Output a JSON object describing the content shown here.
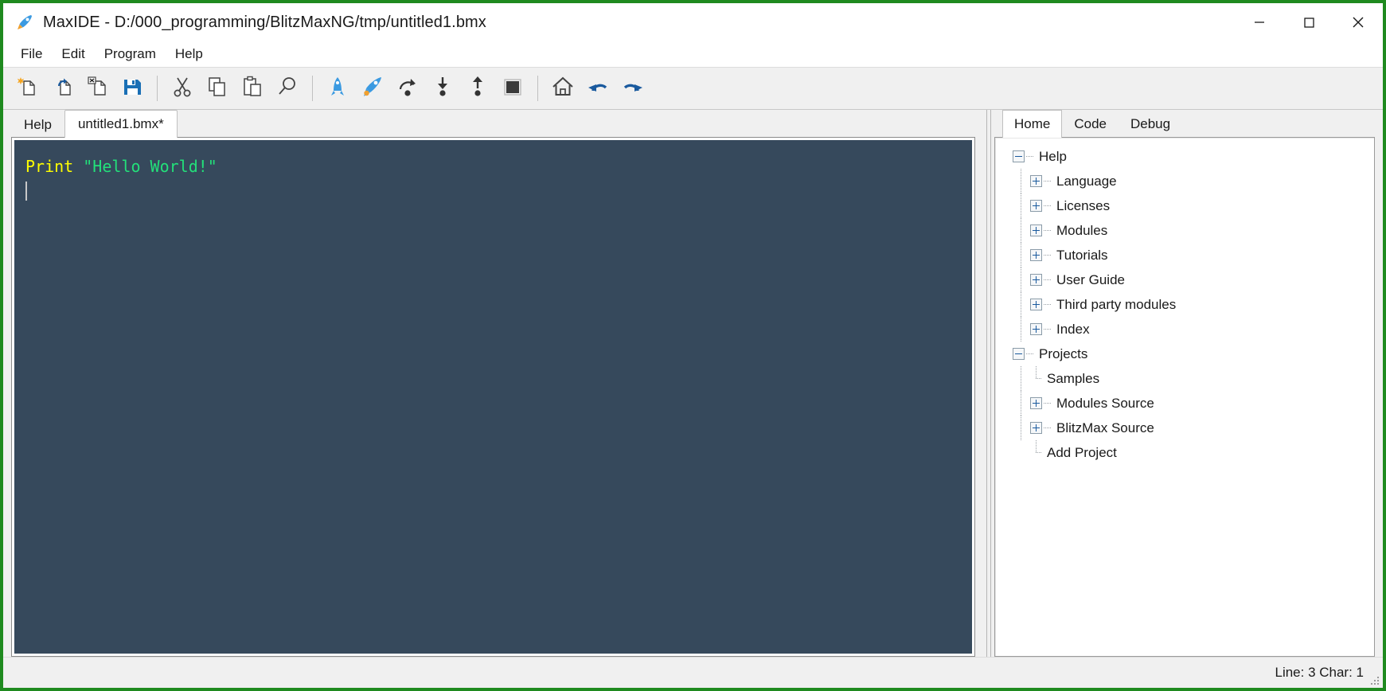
{
  "window": {
    "title": "MaxIDE - D:/000_programming/BlitzMaxNG/tmp/untitled1.bmx",
    "app_icon": "rocket-icon",
    "border_color": "#1f8a1f",
    "controls": {
      "minimize": "minimize-icon",
      "maximize": "maximize-icon",
      "close": "close-icon"
    }
  },
  "menubar": {
    "items": [
      {
        "label": "File"
      },
      {
        "label": "Edit"
      },
      {
        "label": "Program"
      },
      {
        "label": "Help"
      }
    ]
  },
  "toolbar": {
    "groups": [
      {
        "buttons": [
          {
            "name": "new-file-icon",
            "title": "New"
          },
          {
            "name": "open-file-icon",
            "title": "Open"
          },
          {
            "name": "close-file-icon",
            "title": "Close"
          },
          {
            "name": "save-file-icon",
            "title": "Save"
          }
        ]
      },
      {
        "buttons": [
          {
            "name": "cut-icon",
            "title": "Cut"
          },
          {
            "name": "copy-icon",
            "title": "Copy"
          },
          {
            "name": "paste-icon",
            "title": "Paste"
          },
          {
            "name": "search-icon",
            "title": "Find"
          }
        ]
      },
      {
        "buttons": [
          {
            "name": "build-icon",
            "title": "Build"
          },
          {
            "name": "run-icon",
            "title": "Build and Run"
          },
          {
            "name": "step-over-icon",
            "title": "Step Over"
          },
          {
            "name": "step-into-icon",
            "title": "Step Into"
          },
          {
            "name": "step-out-icon",
            "title": "Step Out"
          },
          {
            "name": "stop-icon",
            "title": "Stop"
          }
        ]
      },
      {
        "buttons": [
          {
            "name": "home-icon",
            "title": "Home"
          },
          {
            "name": "undo-icon",
            "title": "Undo"
          },
          {
            "name": "redo-icon",
            "title": "Redo"
          }
        ]
      }
    ]
  },
  "editor": {
    "tabs": [
      {
        "label": "Help",
        "active": false
      },
      {
        "label": "untitled1.bmx*",
        "active": true
      }
    ],
    "background": "#36495c",
    "code": {
      "keyword": "Print",
      "space": " ",
      "string": "\"Hello World!\""
    }
  },
  "help_panel": {
    "tabs": [
      {
        "label": "Home",
        "active": true
      },
      {
        "label": "Code",
        "active": false
      },
      {
        "label": "Debug",
        "active": false
      }
    ],
    "tree": [
      {
        "label": "Help",
        "depth": 0,
        "expander": "minus"
      },
      {
        "label": "Language",
        "depth": 1,
        "expander": "plus"
      },
      {
        "label": "Licenses",
        "depth": 1,
        "expander": "plus"
      },
      {
        "label": "Modules",
        "depth": 1,
        "expander": "plus"
      },
      {
        "label": "Tutorials",
        "depth": 1,
        "expander": "plus"
      },
      {
        "label": "User Guide",
        "depth": 1,
        "expander": "plus"
      },
      {
        "label": "Third party modules",
        "depth": 1,
        "expander": "plus"
      },
      {
        "label": "Index",
        "depth": 1,
        "expander": "plus"
      },
      {
        "label": "Projects",
        "depth": 0,
        "expander": "minus"
      },
      {
        "label": "Samples",
        "depth": 1,
        "expander": "none"
      },
      {
        "label": "Modules Source",
        "depth": 1,
        "expander": "plus"
      },
      {
        "label": "BlitzMax Source",
        "depth": 1,
        "expander": "plus"
      },
      {
        "label": "Add Project",
        "depth": 1,
        "expander": "none"
      }
    ]
  },
  "statusbar": {
    "position": "Line: 3 Char: 1"
  }
}
